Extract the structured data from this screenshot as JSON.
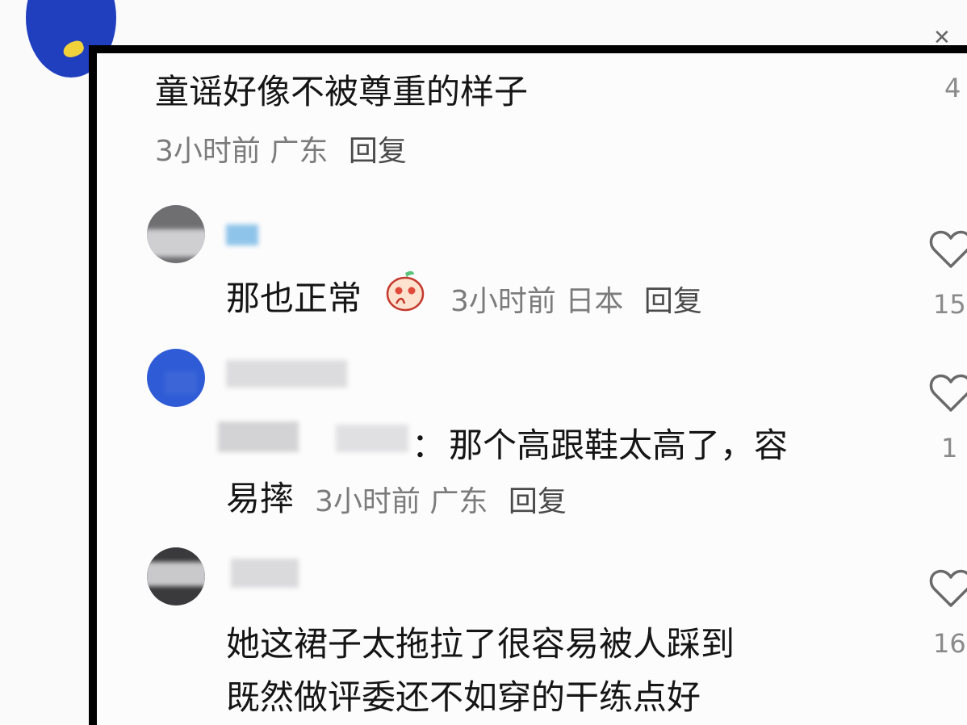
{
  "close_icon": "close-icon",
  "parent_comment": {
    "text": "童谣好像不被尊重的样子",
    "meta": "3小时前 广东",
    "reply_label": "回复",
    "like_count": "4"
  },
  "replies": [
    {
      "text": "那也正常",
      "emoji": "peach-face-emoji",
      "meta": "3小时前 日本",
      "reply_label": "回复",
      "like_count": "15"
    },
    {
      "text_line1": "那个高跟鞋太高了，容",
      "text_line2": "易摔",
      "mention_suffix": "：",
      "meta": "3小时前 广东",
      "reply_label": "回复",
      "like_count": "1"
    },
    {
      "text_line1": "她这裙子太拖拉了很容易被人踩到",
      "text_line2": "既然做评委还不如穿的干练点好",
      "like_count": "16"
    }
  ],
  "colors": {
    "frame": "#000000",
    "primary_text": "#151515",
    "secondary_text": "#7b7b7b",
    "avatar_blue": "#2f5cd6"
  }
}
